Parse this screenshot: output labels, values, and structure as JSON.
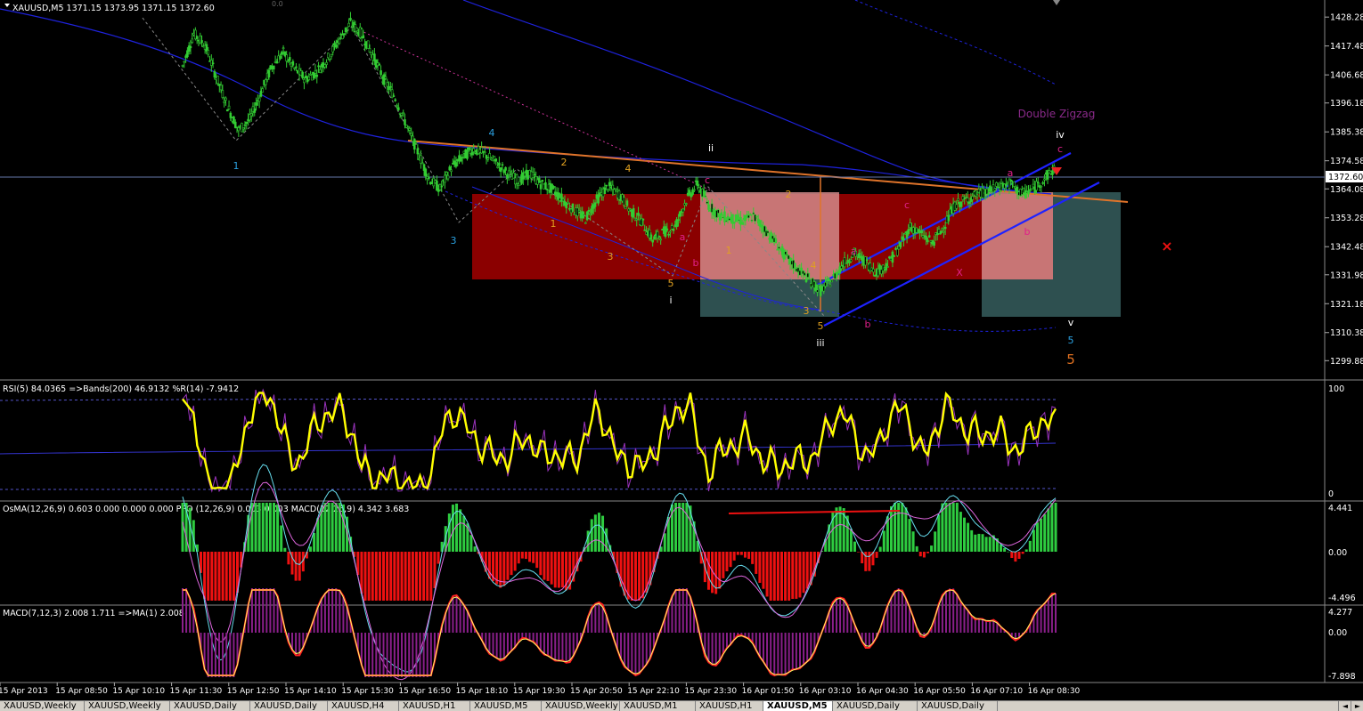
{
  "colors": {
    "background": "#000000",
    "candle": "#33cc33",
    "price_axis_text": "#ffffff",
    "blue_line": "#1e22dd",
    "orange_line": "#e0742a",
    "red_zone": "#8b0000",
    "teal_zone": "#2e5050",
    "pink_zone": "#d28a8a",
    "rsi_line": "#ffff00",
    "rsi_thin": "#9933bb",
    "osma_pos": "#2ecc40",
    "osma_neg": "#ee1111",
    "macd_hist": "#8a1f8a",
    "macd_line": "#ff2222"
  },
  "main": {
    "header": "XAUUSD,M5  1371.15 1373.95 1371.15 1372.60",
    "header_extra": "0.0",
    "current_price_label": "1372.60",
    "price_ticks": [
      "1428.28",
      "1417.48",
      "1406.68",
      "1396.18",
      "1385.38",
      "1374.58",
      "1364.08",
      "1353.28",
      "1342.48",
      "1331.98",
      "1321.18",
      "1310.38",
      "1299.88"
    ],
    "wave_title": "Double Zigzag",
    "wave_labels": [
      {
        "t": "1",
        "c": "#2aa0e0"
      },
      {
        "t": "3",
        "c": "#2aa0e0"
      },
      {
        "t": "4",
        "c": "#2aa0e0"
      },
      {
        "t": "1",
        "c": "#e0a020"
      },
      {
        "t": "2",
        "c": "#e0a020"
      },
      {
        "t": "3",
        "c": "#e0a020"
      },
      {
        "t": "4",
        "c": "#e0a020"
      },
      {
        "t": "5",
        "c": "#e0a020"
      },
      {
        "t": "i",
        "c": "#ffffff"
      },
      {
        "t": "ii",
        "c": "#ffffff"
      },
      {
        "t": "iii",
        "c": "#ffffff"
      },
      {
        "t": "iv",
        "c": "#ffffff"
      },
      {
        "t": "v",
        "c": "#ffffff"
      },
      {
        "t": "a",
        "c": "#e0208a"
      },
      {
        "t": "b",
        "c": "#e0208a"
      },
      {
        "t": "c",
        "c": "#e0208a"
      },
      {
        "t": "1",
        "c": "#e0a020"
      },
      {
        "t": "2",
        "c": "#e0a020"
      },
      {
        "t": "3",
        "c": "#e0a020"
      },
      {
        "t": "4",
        "c": "#e0a020"
      },
      {
        "t": "5",
        "c": "#e0a020"
      },
      {
        "t": "a",
        "c": "#e0208a"
      },
      {
        "t": "b",
        "c": "#e0208a"
      },
      {
        "t": "c",
        "c": "#e0208a"
      },
      {
        "t": "a",
        "c": "#e0208a"
      },
      {
        "t": "b",
        "c": "#e0208a"
      },
      {
        "t": "c",
        "c": "#e0208a"
      },
      {
        "t": "X",
        "c": "#e0208a"
      },
      {
        "t": "5",
        "c": "#2aa0e0"
      },
      {
        "t": "5",
        "c": "#e07020"
      }
    ]
  },
  "rsi_panel": {
    "header": "RSI(5) 84.0365  =>Bands(200) 46.9132  %R(14) -7.9412",
    "ticks": [
      "100",
      "0"
    ]
  },
  "osma_panel": {
    "header": "OsMA(12,26,9) 0.603 0.000 0.000 0.000  PPO (12,26,9) 0.003 0.003  MACD(12,26,9) 4.342 3.683",
    "ticks": [
      "4.441",
      "0.00",
      "-4.496"
    ]
  },
  "macd_panel": {
    "header": "MACD(7,12,3) 2.008 1.711  =>MA(1) 2.008",
    "ticks": [
      "4.277",
      "0.00",
      "-7.898"
    ]
  },
  "time_labels": [
    "15 Apr 2013",
    "15 Apr 08:50",
    "15 Apr 10:10",
    "15 Apr 11:30",
    "15 Apr 12:50",
    "15 Apr 14:10",
    "15 Apr 15:30",
    "15 Apr 16:50",
    "15 Apr 18:10",
    "15 Apr 19:30",
    "15 Apr 20:50",
    "15 Apr 22:10",
    "15 Apr 23:30",
    "16 Apr 01:50",
    "16 Apr 03:10",
    "16 Apr 04:30",
    "16 Apr 05:50",
    "16 Apr 07:10",
    "16 Apr 08:30"
  ],
  "tabs": [
    "XAUUSD,Weekly",
    "XAUUSD,Weekly",
    "XAUUSD,Daily",
    "XAUUSD,Daily",
    "XAUUSD,H4",
    "XAUUSD,H1",
    "XAUUSD,M5",
    "XAUUSD,Weekly",
    "XAUUSD,M1",
    "XAUUSD,H1",
    "XAUUSD,M5",
    "XAUUSD,Daily",
    "XAUUSD,Daily"
  ],
  "active_tab_index": 10,
  "chart_data": {
    "type": "candlestick",
    "symbol": "XAUUSD",
    "timeframe": "M5",
    "ylim": [
      1295,
      1432
    ],
    "y_ticks": [
      1428.28,
      1417.48,
      1406.68,
      1396.18,
      1385.38,
      1374.58,
      1364.08,
      1353.28,
      1342.48,
      1331.98,
      1321.18,
      1310.38,
      1299.88
    ],
    "current_price": 1372.6,
    "close_series": [
      1410,
      1422,
      1418,
      1406,
      1395,
      1386,
      1390,
      1400,
      1410,
      1415,
      1409,
      1405,
      1408,
      1413,
      1420,
      1426,
      1422,
      1414,
      1405,
      1398,
      1388,
      1378,
      1368,
      1364,
      1372,
      1376,
      1379,
      1377,
      1374,
      1370,
      1367,
      1370,
      1366,
      1364,
      1360,
      1356,
      1353,
      1360,
      1365,
      1362,
      1356,
      1352,
      1345,
      1348,
      1350,
      1360,
      1366,
      1358,
      1354,
      1353,
      1352,
      1354,
      1349,
      1344,
      1338,
      1334,
      1330,
      1326,
      1330,
      1336,
      1340,
      1337,
      1333,
      1336,
      1342,
      1350,
      1347,
      1344,
      1350,
      1358,
      1360,
      1362,
      1363,
      1365,
      1366,
      1362,
      1364,
      1368,
      1372
    ],
    "wave_title": "Double Zigzag"
  }
}
